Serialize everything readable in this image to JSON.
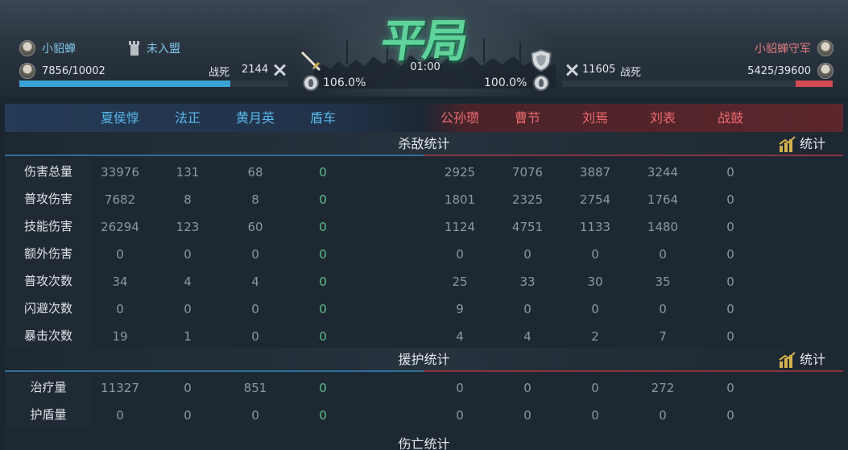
{
  "header": {
    "result": "平局",
    "timer": "01:00",
    "left": {
      "name": "小貂蝉",
      "alliance": "未入盟",
      "troops": "7856/10002",
      "troops_ratio": 0.7854,
      "death_label": "战死",
      "deaths": "2144",
      "buff": "106.0%"
    },
    "right": {
      "name": "小貂蝉守军",
      "troops": "5425/39600",
      "troops_ratio": 0.137,
      "death_label": "战死",
      "deaths": "11605",
      "buff": "100.0%"
    },
    "colors": {
      "left": "#3aa3d6",
      "right": "#d14a55",
      "result": "#5fd39a"
    }
  },
  "heroes": {
    "left": [
      "夏侯惇",
      "法正",
      "黄月英",
      "盾车"
    ],
    "right": [
      "公孙瓒",
      "曹节",
      "刘焉",
      "刘表",
      "战鼓"
    ]
  },
  "sections": {
    "kill": {
      "title": "杀敌统计",
      "button": "统计"
    },
    "support": {
      "title": "援护统计",
      "button": "统计"
    },
    "damage_taken": {
      "title": "伤亡统计"
    }
  },
  "kill_rows": [
    {
      "label": "伤害总量",
      "left": [
        "33976",
        "131",
        "68",
        "0"
      ],
      "right": [
        "2925",
        "7076",
        "3887",
        "3244",
        "0"
      ]
    },
    {
      "label": "普攻伤害",
      "left": [
        "7682",
        "8",
        "8",
        "0"
      ],
      "right": [
        "1801",
        "2325",
        "2754",
        "1764",
        "0"
      ]
    },
    {
      "label": "技能伤害",
      "left": [
        "26294",
        "123",
        "60",
        "0"
      ],
      "right": [
        "1124",
        "4751",
        "1133",
        "1480",
        "0"
      ]
    },
    {
      "label": "额外伤害",
      "left": [
        "0",
        "0",
        "0",
        "0"
      ],
      "right": [
        "0",
        "0",
        "0",
        "0",
        "0"
      ]
    },
    {
      "label": "普攻次数",
      "left": [
        "34",
        "4",
        "4",
        "0"
      ],
      "right": [
        "25",
        "33",
        "30",
        "35",
        "0"
      ]
    },
    {
      "label": "闪避次数",
      "left": [
        "0",
        "0",
        "0",
        "0"
      ],
      "right": [
        "9",
        "0",
        "0",
        "0",
        "0"
      ]
    },
    {
      "label": "暴击次数",
      "left": [
        "19",
        "1",
        "0",
        "0"
      ],
      "right": [
        "4",
        "4",
        "2",
        "7",
        "0"
      ]
    }
  ],
  "support_rows": [
    {
      "label": "治疗量",
      "left": [
        "11327",
        "0",
        "851",
        "0"
      ],
      "right": [
        "0",
        "0",
        "0",
        "272",
        "0"
      ]
    },
    {
      "label": "护盾量",
      "left": [
        "0",
        "0",
        "0",
        "0"
      ],
      "right": [
        "0",
        "0",
        "0",
        "0",
        "0"
      ]
    }
  ]
}
